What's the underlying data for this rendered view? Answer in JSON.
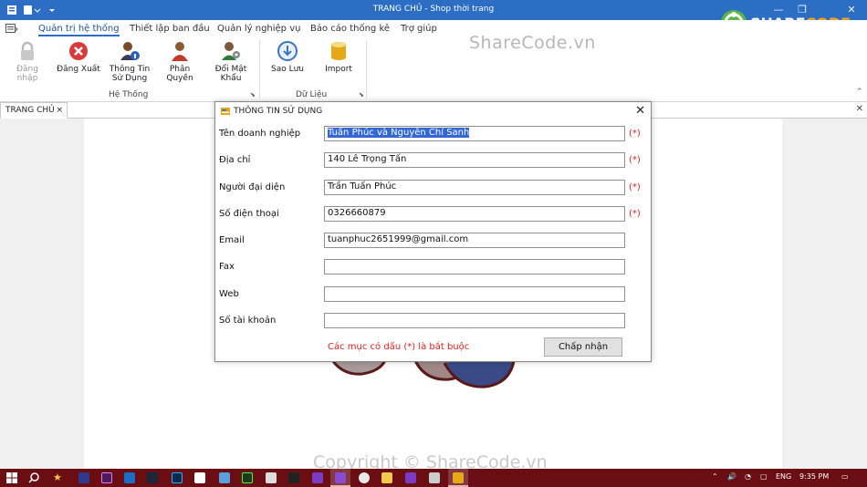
{
  "window": {
    "title": "TRANG CHỦ - Shop thời trang",
    "controls": [
      "minimize-icon",
      "restore-icon",
      "close-icon"
    ]
  },
  "menu": {
    "items": [
      {
        "label": "Quản trị hệ thống",
        "active": true
      },
      {
        "label": "Thiết lập ban đầu",
        "active": false
      },
      {
        "label": "Quản lý nghiệp vụ",
        "active": false
      },
      {
        "label": "Báo cáo thống kê",
        "active": false
      },
      {
        "label": "Trợ giúp",
        "active": false
      }
    ]
  },
  "ribbon": {
    "groups": [
      {
        "label": "Hệ Thống",
        "buttons": [
          {
            "label": "Đăng nhập",
            "icon": "lock-icon",
            "enabled": false
          },
          {
            "label": "Đăng Xuất",
            "icon": "logout-icon",
            "enabled": true
          },
          {
            "label": "Thông Tin Sử Dụng",
            "icon": "user-info-icon",
            "enabled": true
          },
          {
            "label": "Phân Quyền",
            "icon": "user-permission-icon",
            "enabled": true
          },
          {
            "label": "Đổi Mật Khẩu",
            "icon": "change-password-icon",
            "enabled": true
          }
        ]
      },
      {
        "label": "Dữ Liệu",
        "buttons": [
          {
            "label": "Sao Lưu",
            "icon": "backup-icon",
            "enabled": true
          },
          {
            "label": "Import",
            "icon": "database-icon",
            "enabled": true
          }
        ]
      }
    ]
  },
  "watermark": {
    "top": "ShareCode.vn",
    "bottom": "Copyright © ShareCode.vn",
    "logo_main": "SHARE",
    "logo_accent": "CODE",
    "logo_suffix": ".vn"
  },
  "tabs": [
    {
      "label": "TRANG CHỦ",
      "close": "×"
    }
  ],
  "dialog": {
    "title": "THÔNG TIN SỬ DỤNG",
    "close": "✕",
    "fields": [
      {
        "label": "Tên doanh nghiệp",
        "value": "Tuấn Phúc và Nguyễn Chí Sanh",
        "required": true,
        "selected": true
      },
      {
        "label": "Địa chỉ",
        "value": "140 Lê Trọng Tấn",
        "required": true
      },
      {
        "label": "Người đại diện",
        "value": "Trần Tuấn Phúc",
        "required": true
      },
      {
        "label": "Số điện thoại",
        "value": "0326660879",
        "required": true
      },
      {
        "label": "Email",
        "value": "tuanphuc2651999@gmail.com",
        "required": false
      },
      {
        "label": "Fax",
        "value": "",
        "required": false
      },
      {
        "label": "Web",
        "value": "",
        "required": false
      },
      {
        "label": "Số tài khoản",
        "value": "",
        "required": false
      }
    ],
    "required_mark": "(*)",
    "note": "Các mục có dấu (*) là bắt buộc",
    "ok_label": "Chấp nhận"
  },
  "taskbar": {
    "language": "ENG",
    "time": "9:35 PM"
  },
  "colors": {
    "titlebar": "#2b6ec4",
    "taskbar": "#6b0e14",
    "required": "#dd2222",
    "selection": "#3367d6"
  }
}
